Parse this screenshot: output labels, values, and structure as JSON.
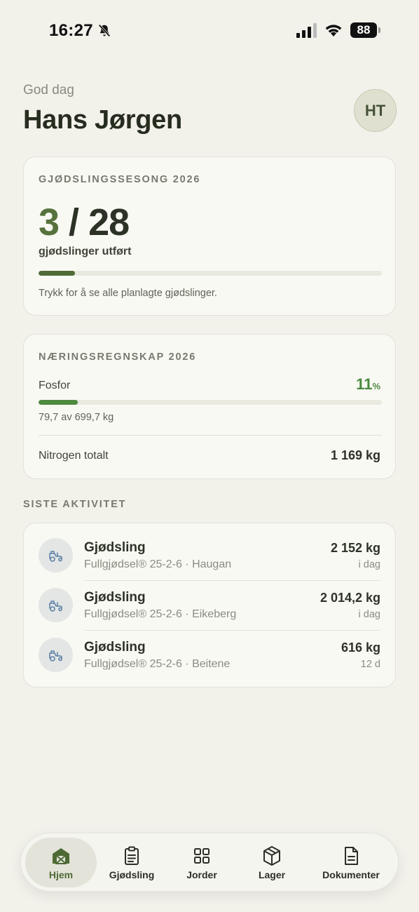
{
  "status_bar": {
    "time": "16:27",
    "battery": "88",
    "icons": [
      "bell-slash-icon",
      "signal-icon",
      "wifi-icon",
      "battery-icon"
    ]
  },
  "header": {
    "greeting": "God dag",
    "name": "Hans Jørgen",
    "avatar_initials": "HT"
  },
  "season": {
    "title": "GJØDSLINGSSESONG 2026",
    "done": "3",
    "separator": " / ",
    "total": "28",
    "subtitle": "gjødslinger utført",
    "progress": 0.107,
    "hint": "Trykk for å se alle planlagte gjødslinger."
  },
  "nutrients": {
    "title": "NÆRINGSREGNSKAP 2026",
    "phosphorus_label": "Fosfor",
    "phosphorus_percent": "11",
    "percent_unit": "%",
    "phosphorus_progress": 0.114,
    "phosphorus_amount": "79,7 av 699,7 kg",
    "nitrogen_label": "Nitrogen totalt",
    "nitrogen_value": "1 169 kg"
  },
  "activity": {
    "section_title": "SISTE AKTIVITET",
    "items": [
      {
        "title": "Gjødsling",
        "subtitle": "Fullgjødsel® 25-2-6 · Haugan",
        "quantity": "2 152 kg",
        "when": "i dag",
        "icon": "tractor-icon"
      },
      {
        "title": "Gjødsling",
        "subtitle": "Fullgjødsel® 25-2-6 · Eikeberg",
        "quantity": "2 014,2 kg",
        "when": "i dag",
        "icon": "tractor-icon"
      },
      {
        "title": "Gjødsling",
        "subtitle": "Fullgjødsel® 25-2-6 · Beitene",
        "quantity": "616 kg",
        "when": "12 d",
        "icon": "tractor-icon"
      }
    ]
  },
  "nav": {
    "items": [
      {
        "label": "Hjem",
        "icon": "barn-icon",
        "active": true
      },
      {
        "label": "Gjødsling",
        "icon": "clipboard-icon",
        "active": false
      },
      {
        "label": "Jorder",
        "icon": "grid-icon",
        "active": false
      },
      {
        "label": "Lager",
        "icon": "box-icon",
        "active": false
      },
      {
        "label": "Dokumenter",
        "icon": "document-icon",
        "active": false
      }
    ]
  },
  "colors": {
    "accent": "#56723d",
    "progress_green": "#4e8a3f",
    "background": "#f2f1ea",
    "card": "#f9f9f3"
  }
}
